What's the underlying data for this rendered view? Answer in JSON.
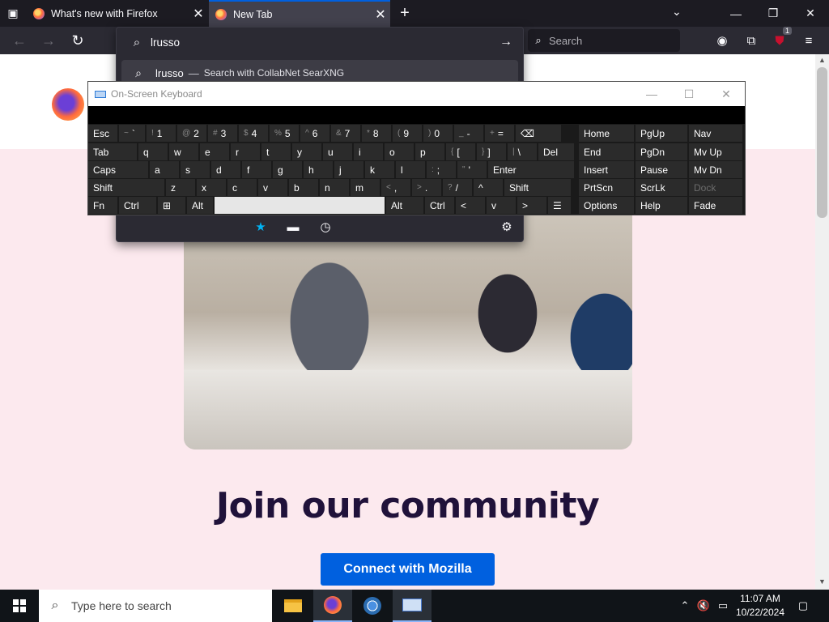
{
  "browser": {
    "tabs": [
      {
        "title": "What's new with Firefox",
        "active": false
      },
      {
        "title": "New Tab",
        "active": true
      }
    ],
    "address": {
      "value": "lrusso",
      "suggestion_text": "lrusso",
      "suggestion_separator": "—",
      "suggestion_engine": "Search with CollabNet SearXNG"
    },
    "search_placeholder": "Search",
    "extension_badge": "1"
  },
  "page": {
    "heading": "Join our community",
    "cta_label": "Connect with Mozilla"
  },
  "osk": {
    "title": "On-Screen Keyboard",
    "rows": [
      [
        {
          "l": "Esc"
        },
        {
          "s": "~",
          "l": "`"
        },
        {
          "s": "!",
          "l": "1"
        },
        {
          "s": "@",
          "l": "2"
        },
        {
          "s": "#",
          "l": "3"
        },
        {
          "s": "$",
          "l": "4"
        },
        {
          "s": "%",
          "l": "5"
        },
        {
          "s": "^",
          "l": "6"
        },
        {
          "s": "&",
          "l": "7"
        },
        {
          "s": "*",
          "l": "8"
        },
        {
          "s": "(",
          "l": "9"
        },
        {
          "s": ")",
          "l": "0"
        },
        {
          "s": "_",
          "l": "-"
        },
        {
          "s": "+",
          "l": "="
        },
        {
          "l": "⌫"
        },
        {
          "l": "Home"
        },
        {
          "l": "PgUp"
        },
        {
          "l": "Nav"
        }
      ],
      [
        {
          "l": "Tab"
        },
        {
          "l": "q"
        },
        {
          "l": "w"
        },
        {
          "l": "e"
        },
        {
          "l": "r"
        },
        {
          "l": "t"
        },
        {
          "l": "y"
        },
        {
          "l": "u"
        },
        {
          "l": "i"
        },
        {
          "l": "o"
        },
        {
          "l": "p"
        },
        {
          "s": "{",
          "l": "["
        },
        {
          "s": "}",
          "l": "]"
        },
        {
          "s": "|",
          "l": "\\"
        },
        {
          "l": "Del"
        },
        {
          "l": "End"
        },
        {
          "l": "PgDn"
        },
        {
          "l": "Mv Up"
        }
      ],
      [
        {
          "l": "Caps"
        },
        {
          "l": "a"
        },
        {
          "l": "s"
        },
        {
          "l": "d"
        },
        {
          "l": "f"
        },
        {
          "l": "g"
        },
        {
          "l": "h"
        },
        {
          "l": "j"
        },
        {
          "l": "k"
        },
        {
          "l": "l"
        },
        {
          "s": ":",
          "l": ";"
        },
        {
          "s": "\"",
          "l": "'"
        },
        {
          "l": "Enter"
        },
        {
          "l": "Insert"
        },
        {
          "l": "Pause"
        },
        {
          "l": "Mv Dn"
        }
      ],
      [
        {
          "l": "Shift"
        },
        {
          "l": "z"
        },
        {
          "l": "x"
        },
        {
          "l": "c"
        },
        {
          "l": "v"
        },
        {
          "l": "b"
        },
        {
          "l": "n"
        },
        {
          "l": "m"
        },
        {
          "s": "<",
          "l": ","
        },
        {
          "s": ">",
          "l": "."
        },
        {
          "s": "?",
          "l": "/"
        },
        {
          "l": "^"
        },
        {
          "l": "Shift"
        },
        {
          "l": "PrtScn"
        },
        {
          "l": "ScrLk"
        },
        {
          "l": "Dock"
        }
      ],
      [
        {
          "l": "Fn"
        },
        {
          "l": "Ctrl"
        },
        {
          "l": "⊞"
        },
        {
          "l": "Alt"
        },
        {
          "l": ""
        },
        {
          "l": "Alt"
        },
        {
          "l": "Ctrl"
        },
        {
          "l": "<"
        },
        {
          "l": "v"
        },
        {
          "l": ">"
        },
        {
          "l": "☰"
        },
        {
          "l": "Options"
        },
        {
          "l": "Help"
        },
        {
          "l": "Fade"
        }
      ]
    ]
  },
  "taskbar": {
    "search_placeholder": "Type here to search",
    "time": "11:07 AM",
    "date": "10/22/2024"
  }
}
